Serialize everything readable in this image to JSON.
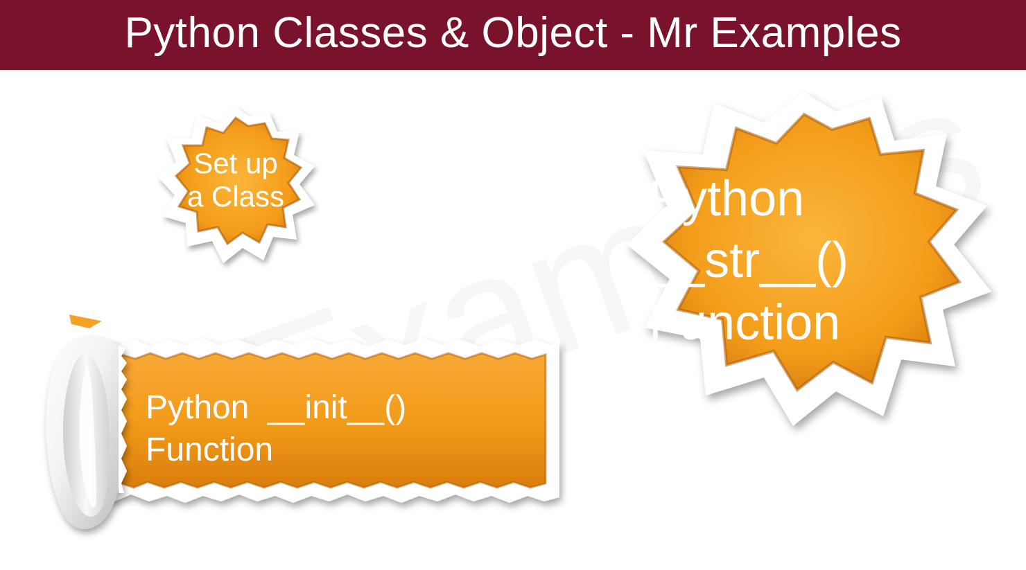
{
  "header": {
    "title": "Python Classes & Object - Mr Examples"
  },
  "watermark": "MrExamples",
  "smallCircle": {
    "line1": "Set up",
    "line2": "a Class"
  },
  "largeCircle": {
    "line1": "Python",
    "line2": "__str__()",
    "line3": "Function"
  },
  "tornRect": {
    "line1": "Python  __init__()",
    "line2": "Function"
  },
  "colors": {
    "header": "#78132b",
    "orange": "#f39c1a",
    "orangeDark": "#d97a0b"
  }
}
